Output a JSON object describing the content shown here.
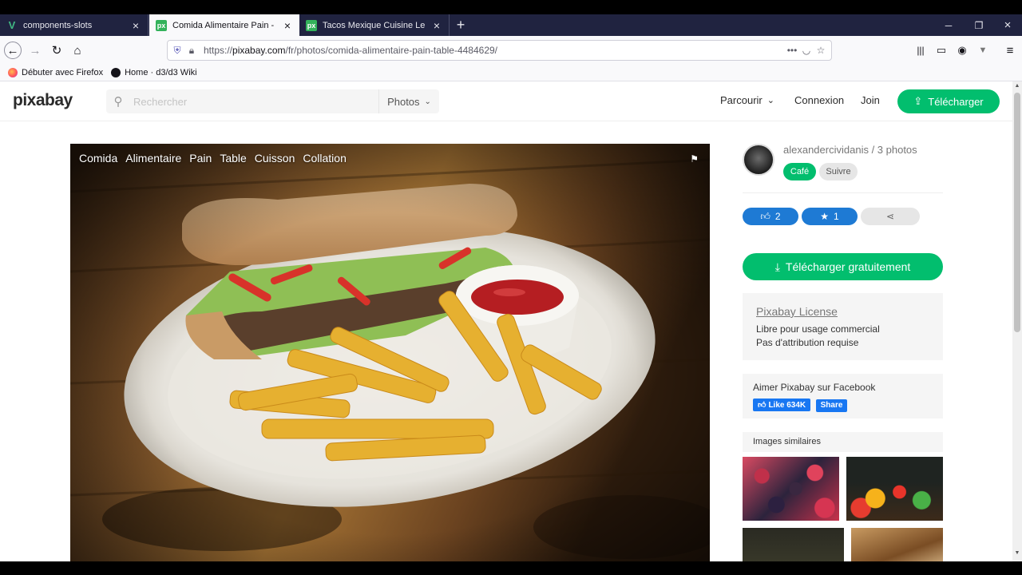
{
  "browser": {
    "tabs": [
      {
        "title": "components-slots",
        "icon": "vue-icon",
        "active": false
      },
      {
        "title": "Comida Alimentaire Pain - Pho",
        "icon": "pixabay-icon",
        "active": true
      },
      {
        "title": "Tacos Mexique Cuisine Le - Pho",
        "icon": "pixabay-icon",
        "active": false
      }
    ],
    "url_prefix": "https://",
    "url_domain": "pixabay.com",
    "url_path": "/fr/photos/comida-alimentaire-pain-table-4484629/",
    "bookmarks": [
      "Débuter avec Firefox",
      "Home · d3/d3 Wiki"
    ],
    "accent_tab_bar": "#202340"
  },
  "header": {
    "logo": "pixabay",
    "search_placeholder": "Rechercher",
    "search_type": "Photos",
    "nav_explore": "Parcourir",
    "nav_login": "Connexion",
    "nav_join": "Join",
    "upload_label": "Télécharger",
    "accent": "#02be6e"
  },
  "photo": {
    "tags": [
      "Comida",
      "Alimentaire",
      "Pain",
      "Table",
      "Cuisson",
      "Collation"
    ]
  },
  "sidebar": {
    "author": "alexandercividanis / 3 photos",
    "collection_tag": "Café",
    "follow_label": "Suivre",
    "likes": "2",
    "favorites": "1",
    "download_label": "Télécharger gratuitement",
    "license_title": "Pixabay License",
    "license_lines": [
      "Libre pour usage commercial",
      "Pas d'attribution requise"
    ],
    "facebook_title": "Aimer Pixabay sur Facebook",
    "fb_like": "Like 634K",
    "fb_share": "Share",
    "similar_title": "Images similaires"
  }
}
